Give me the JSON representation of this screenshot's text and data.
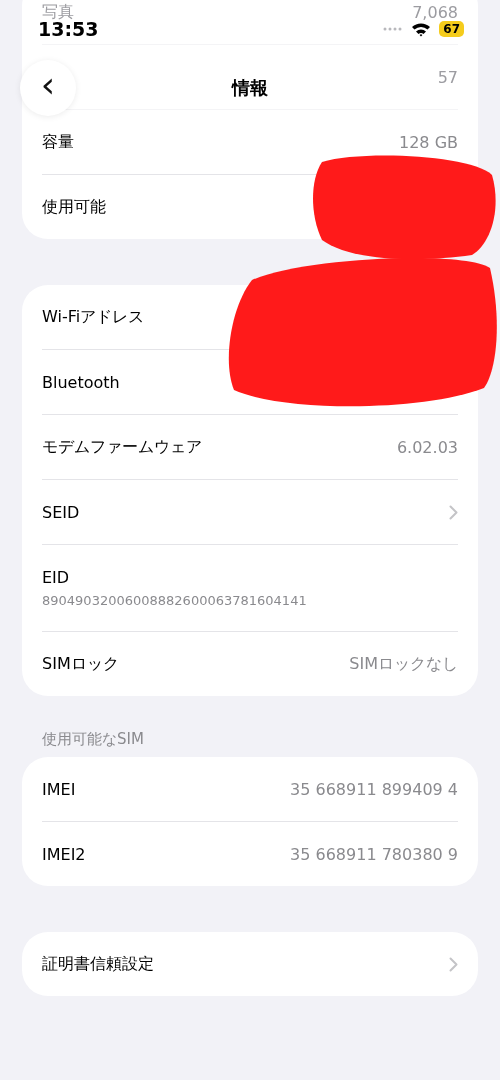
{
  "status_bar": {
    "time": "13:53",
    "battery": "67"
  },
  "nav": {
    "title": "情報",
    "back": "‹"
  },
  "sections": [
    {
      "rows": [
        {
          "kind": "faded",
          "label": "写真",
          "value": "7,068"
        },
        {
          "kind": "faded",
          "value": "57"
        },
        {
          "kind": "value",
          "label": "容量",
          "value": "128 GB"
        },
        {
          "kind": "value",
          "label": "使用可能"
        }
      ]
    },
    {
      "rows": [
        {
          "kind": "value",
          "label": "Wi-Fiアドレス"
        },
        {
          "kind": "value",
          "label": "Bluetooth"
        },
        {
          "kind": "value",
          "label": "モデムファームウェア",
          "value": "6.02.03"
        },
        {
          "kind": "chevron",
          "label": "SEID"
        },
        {
          "kind": "subtitle",
          "label": "EID",
          "value": "89049032006008882600063781604141"
        },
        {
          "kind": "value",
          "label": "SIMロック",
          "value": "SIMロックなし"
        }
      ]
    },
    {
      "header": "使用可能なSIM",
      "rows": [
        {
          "kind": "value",
          "label": "IMEI",
          "value": "35 668911 899409 4"
        },
        {
          "kind": "value",
          "label": "IMEI2",
          "value": "35 668911 780380 9"
        }
      ]
    },
    {
      "rows": [
        {
          "kind": "chevron",
          "label": "証明書信頼設定"
        }
      ]
    }
  ]
}
